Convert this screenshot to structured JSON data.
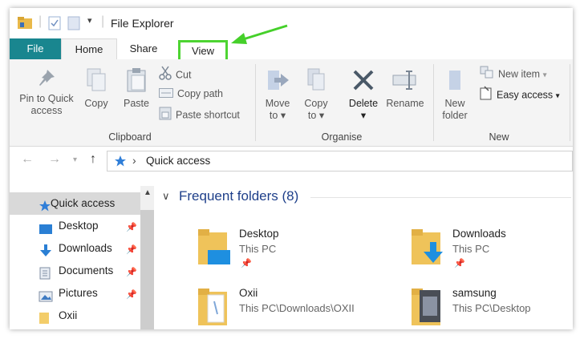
{
  "window": {
    "title": "File Explorer"
  },
  "tabs": {
    "file": "File",
    "home": "Home",
    "share": "Share",
    "view": "View"
  },
  "ribbon": {
    "clipboard": {
      "label": "Clipboard",
      "pin_line1": "Pin to Quick",
      "pin_line2": "access",
      "copy": "Copy",
      "paste": "Paste",
      "cut": "Cut",
      "copy_path": "Copy path",
      "paste_shortcut": "Paste shortcut"
    },
    "organise": {
      "label": "Organise",
      "move_line1": "Move",
      "move_line2": "to",
      "copy_line1": "Copy",
      "copy_line2": "to",
      "delete": "Delete",
      "rename": "Rename"
    },
    "new": {
      "label": "New",
      "folder_line1": "New",
      "folder_line2": "folder",
      "new_item": "New item",
      "easy_access": "Easy access"
    }
  },
  "address": {
    "crumb_sep": "›",
    "location": "Quick access"
  },
  "sidebar": {
    "items": [
      {
        "label": "Quick access"
      },
      {
        "label": "Desktop"
      },
      {
        "label": "Downloads"
      },
      {
        "label": "Documents"
      },
      {
        "label": "Pictures"
      },
      {
        "label": "Oxii"
      }
    ]
  },
  "main": {
    "section_title": "Frequent folders (8)",
    "folders": [
      {
        "name": "Desktop",
        "location": "This PC"
      },
      {
        "name": "Downloads",
        "location": "This PC"
      },
      {
        "name": "Oxii",
        "location": "This PC\\Downloads\\OXII"
      },
      {
        "name": "samsung",
        "location": "This PC\\Desktop"
      }
    ]
  },
  "colors": {
    "file_tab": "#19868f",
    "highlight": "#4dd432",
    "section_title": "#1e3f8a"
  }
}
